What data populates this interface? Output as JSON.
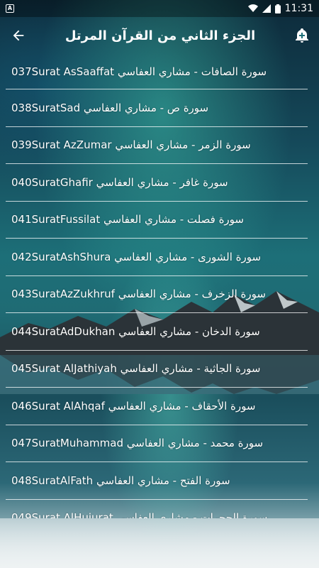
{
  "status_bar": {
    "time": "11:31",
    "notification_icon": "A"
  },
  "app_bar": {
    "title": "الجزء الثاني من القرآن المرتل",
    "back_icon": "arrow-left",
    "add_icon": "bell-plus"
  },
  "list": [
    {
      "label": "037Surat AsSaaffat سورة الصافات - مشاري العفاسي"
    },
    {
      "label": "038SuratSad سورة ص - مشاري العفاسي"
    },
    {
      "label": "039Surat AzZumar سورة الزمر - مشاري العفاسي"
    },
    {
      "label": "040SuratGhafir سورة غافر - مشاري العفاسي"
    },
    {
      "label": "041SuratFussilat سورة فصلت - مشاري العفاسي"
    },
    {
      "label": "042SuratAshShura سورة الشورى - مشاري العفاسي"
    },
    {
      "label": "043SuratAzZukhruf سورة الزخرف - مشاري العفاسي"
    },
    {
      "label": "044SuratAdDukhan سورة الدخان - مشاري العفاسي"
    },
    {
      "label": "045Surat AlJathiyah سورة الجاثية - مشاري العفاسي"
    },
    {
      "label": "046Surat AlAhqaf سورة الأحقاف - مشاري العفاسي"
    },
    {
      "label": "047SuratMuhammad سورة محمد - مشاري العفاسي"
    },
    {
      "label": "048SuratAlFath سورة الفتح - مشاري العفاسي"
    },
    {
      "label": "049Surat AlHujurat سورة الحجرات - مشاري العفاسي"
    }
  ]
}
